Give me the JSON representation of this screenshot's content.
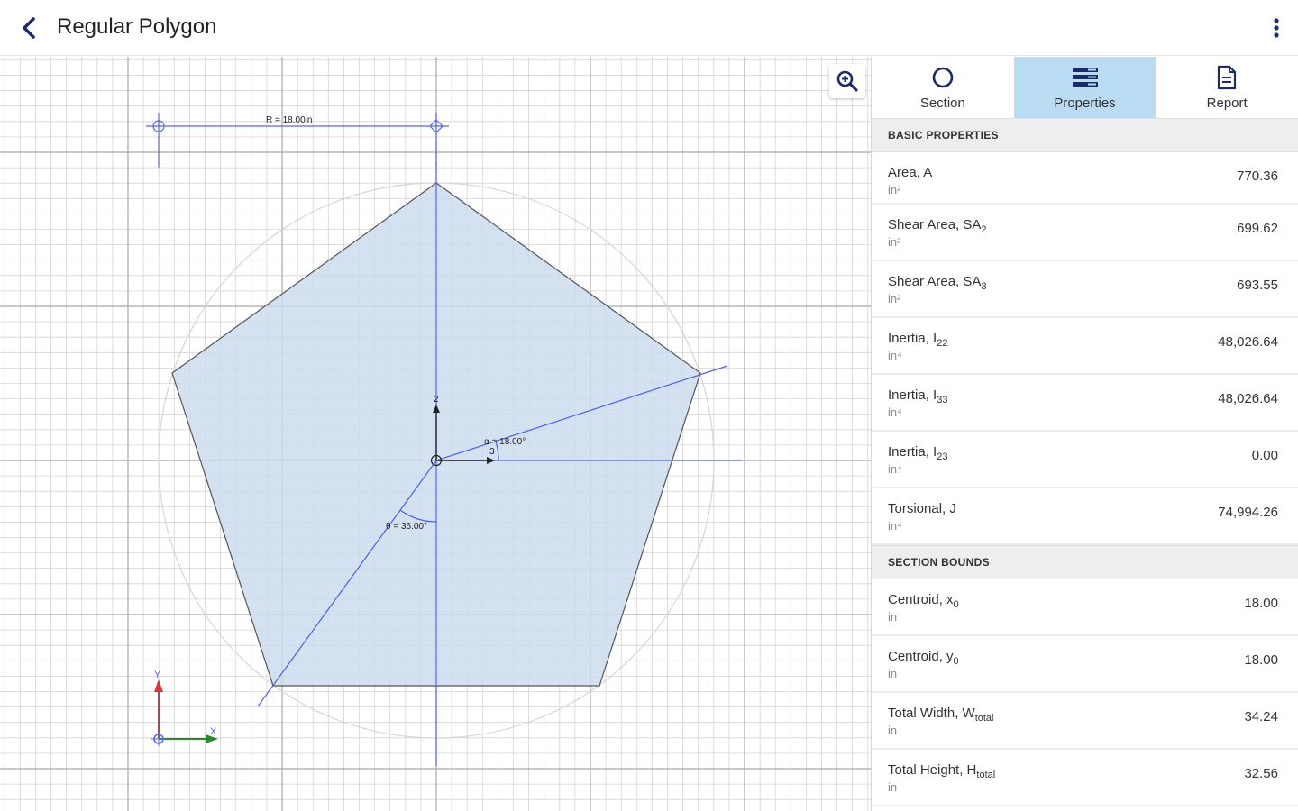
{
  "header": {
    "title": "Regular Polygon"
  },
  "canvas": {
    "radius_label": "R = 18.00in",
    "alpha_label": "α = 18.00°",
    "theta_label": "θ = 36.00°",
    "axis_z": "2",
    "axis_y": "3",
    "coord_y": "Y",
    "coord_x": "X",
    "fill_color": "#cbdced",
    "accent_color": "#4a5ff0"
  },
  "tabs": [
    {
      "label": "Section",
      "icon": "circle-icon"
    },
    {
      "label": "Properties",
      "icon": "properties-icon"
    },
    {
      "label": "Report",
      "icon": "report-icon"
    }
  ],
  "basic": {
    "header": "BASIC PROPERTIES",
    "rows": [
      {
        "name": "Area, A",
        "sub": "",
        "unit": "in²",
        "value": "770.36"
      },
      {
        "name": "Shear Area, SA",
        "sub": "2",
        "unit": "in²",
        "value": "699.62"
      },
      {
        "name": "Shear Area, SA",
        "sub": "3",
        "unit": "in²",
        "value": "693.55"
      },
      {
        "name": "Inertia, I",
        "sub": "22",
        "unit": "in⁴",
        "value": "48,026.64"
      },
      {
        "name": "Inertia, I",
        "sub": "33",
        "unit": "in⁴",
        "value": "48,026.64"
      },
      {
        "name": "Inertia, I",
        "sub": "23",
        "unit": "in⁴",
        "value": "0.00"
      },
      {
        "name": "Torsional, J",
        "sub": "",
        "unit": "in⁴",
        "value": "74,994.26"
      }
    ]
  },
  "bounds": {
    "header": "SECTION BOUNDS",
    "rows": [
      {
        "name": "Centroid, x",
        "sub": "0",
        "unit": "in",
        "value": "18.00"
      },
      {
        "name": "Centroid, y",
        "sub": "0",
        "unit": "in",
        "value": "18.00"
      },
      {
        "name": "Total Width, W",
        "sub": "total",
        "unit": "in",
        "value": "34.24"
      },
      {
        "name": "Total Height, H",
        "sub": "total",
        "unit": "in",
        "value": "32.56"
      }
    ]
  }
}
